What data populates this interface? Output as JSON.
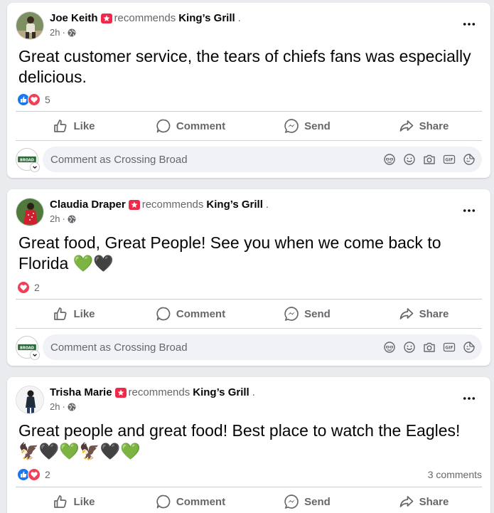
{
  "recommend_text": "recommends",
  "business_name": "King’s Grill",
  "dot_sep": ".",
  "time_sep": "·",
  "actions": {
    "like": "Like",
    "comment": "Comment",
    "send": "Send",
    "share": "Share"
  },
  "comment_placeholder": "Comment as Crossing Broad",
  "page_avatar_text": "BROAD",
  "posts": [
    {
      "author": "Joe Keith",
      "time": "2h",
      "text": "Great customer service, the tears of chiefs fans was especially delicious.",
      "reaction_icons": [
        "like-icon",
        "love-icon"
      ],
      "reaction_count": "5",
      "comment_count": ""
    },
    {
      "author": "Claudia Draper",
      "time": "2h",
      "text": "Great food, Great People! See you when we come back to Florida 💚🖤",
      "reaction_icons": [
        "love-icon"
      ],
      "reaction_count": "2",
      "comment_count": ""
    },
    {
      "author": "Trisha Marie",
      "time": "2h",
      "text": "Great people and great food! Best place to watch the Eagles! 🦅🖤💚🦅🖤💚",
      "reaction_icons": [
        "like-icon",
        "love-icon"
      ],
      "reaction_count": "2",
      "comment_count": "3 comments"
    }
  ],
  "comment_tools": [
    "avatar-sticker-icon",
    "emoji-icon",
    "camera-icon",
    "gif-icon",
    "sticker-icon"
  ],
  "colors": {
    "like_blue": "#1877f2",
    "love_red": "#f33e58",
    "recommend_red": "#f02849",
    "muted_text": "#65676b"
  }
}
